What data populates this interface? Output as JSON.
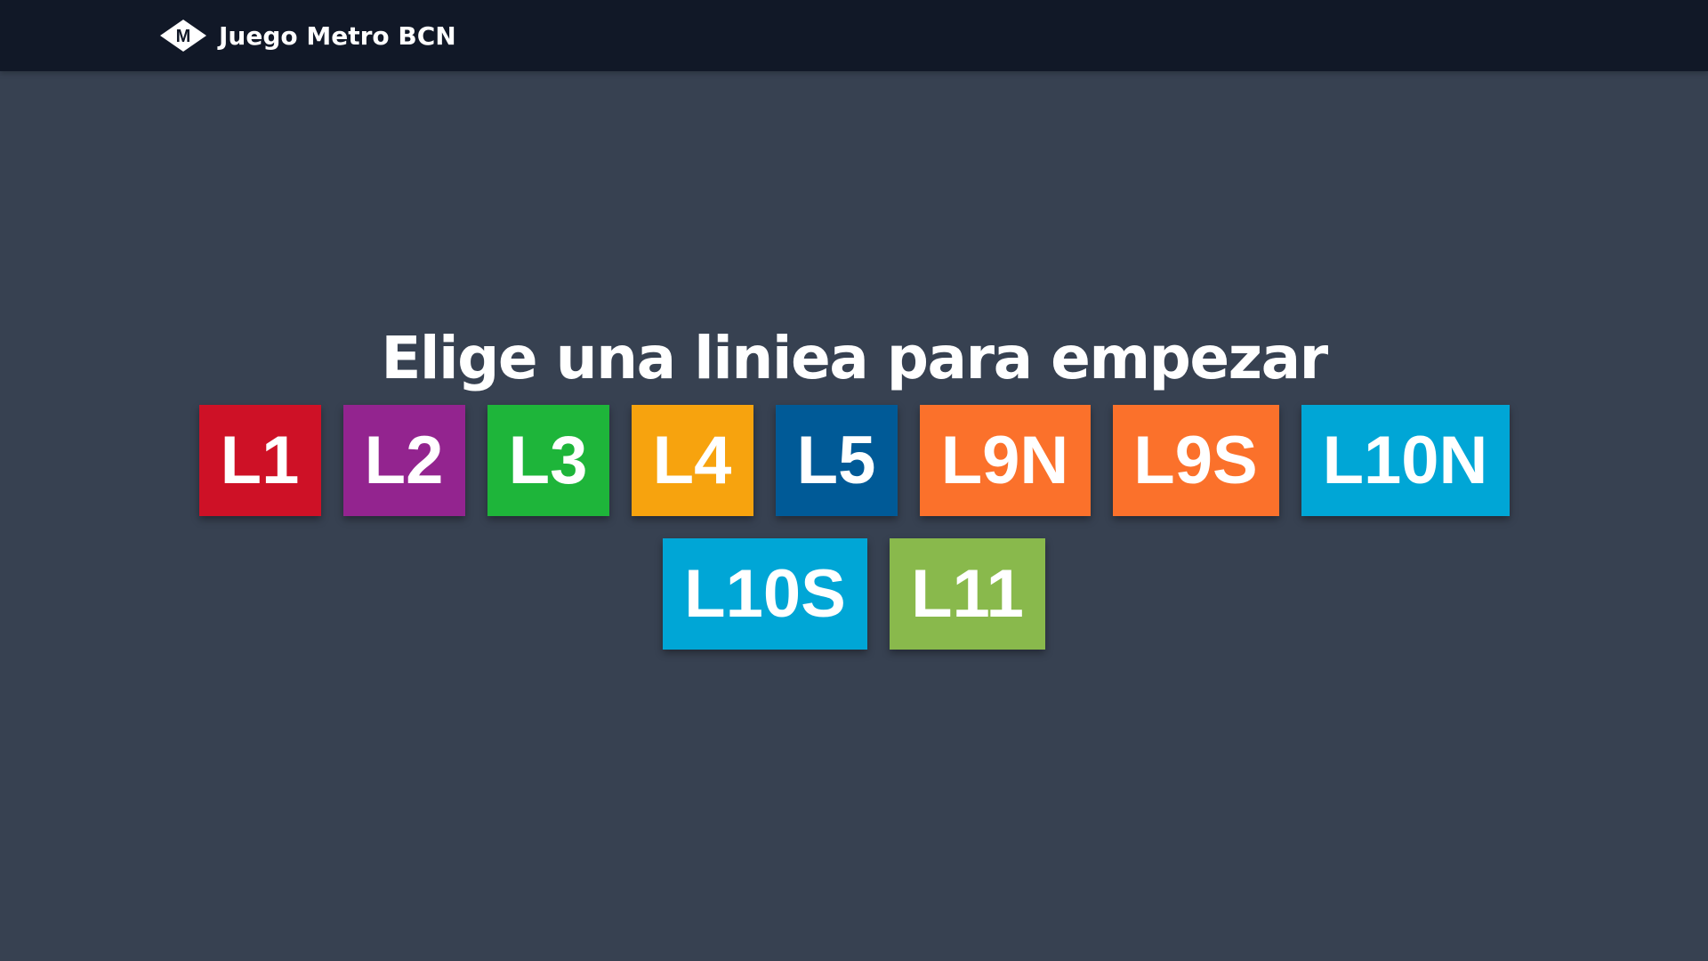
{
  "header": {
    "logo_icon": "metro-diamond-m-icon",
    "logo_letter": "M",
    "title": "Juego Metro BCN"
  },
  "main": {
    "heading": "Elige una liniea para empezar",
    "lines": [
      {
        "label": "L1",
        "color": "#CE1126"
      },
      {
        "label": "L2",
        "color": "#93248F"
      },
      {
        "label": "L3",
        "color": "#1EB53A"
      },
      {
        "label": "L4",
        "color": "#F7A30E"
      },
      {
        "label": "L5",
        "color": "#005A97"
      },
      {
        "label": "L9N",
        "color": "#FB712B"
      },
      {
        "label": "L9S",
        "color": "#FB712B"
      },
      {
        "label": "L10N",
        "color": "#00A6D6"
      },
      {
        "label": "L10S",
        "color": "#00A6D6"
      },
      {
        "label": "L11",
        "color": "#89B94C"
      }
    ]
  }
}
